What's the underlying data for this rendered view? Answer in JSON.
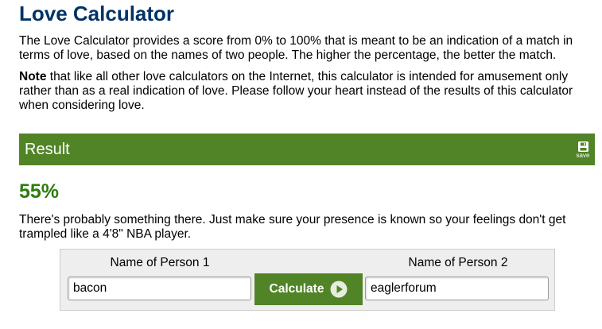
{
  "page": {
    "title": "Love Calculator",
    "intro": "The Love Calculator provides a score from 0% to 100% that is meant to be an indication of a match in terms of love, based on the names of two people. The higher the percentage, the better the match.",
    "note_bold": "Note",
    "note_rest": " that like all other love calculators on the Internet, this calculator is intended for amusement only rather than as a real indication of love. Please follow your heart instead of the results of this calculator when considering love."
  },
  "result": {
    "heading": "Result",
    "save_label": "save",
    "score": "55%",
    "message": "There's probably something there. Just make sure your presence is known so your feelings don't get trampled like a 4'8\" NBA player."
  },
  "form": {
    "person1_label": "Name of Person 1",
    "person1_value": "bacon",
    "person2_label": "Name of Person 2",
    "person2_value": "eaglerforum",
    "calculate_label": "Calculate"
  },
  "colors": {
    "title": "#003366",
    "accent_green": "#518426",
    "score_green": "#2e7d0c"
  },
  "icons": {
    "save": "floppy-disk-icon",
    "calculate": "play-circle-icon"
  }
}
